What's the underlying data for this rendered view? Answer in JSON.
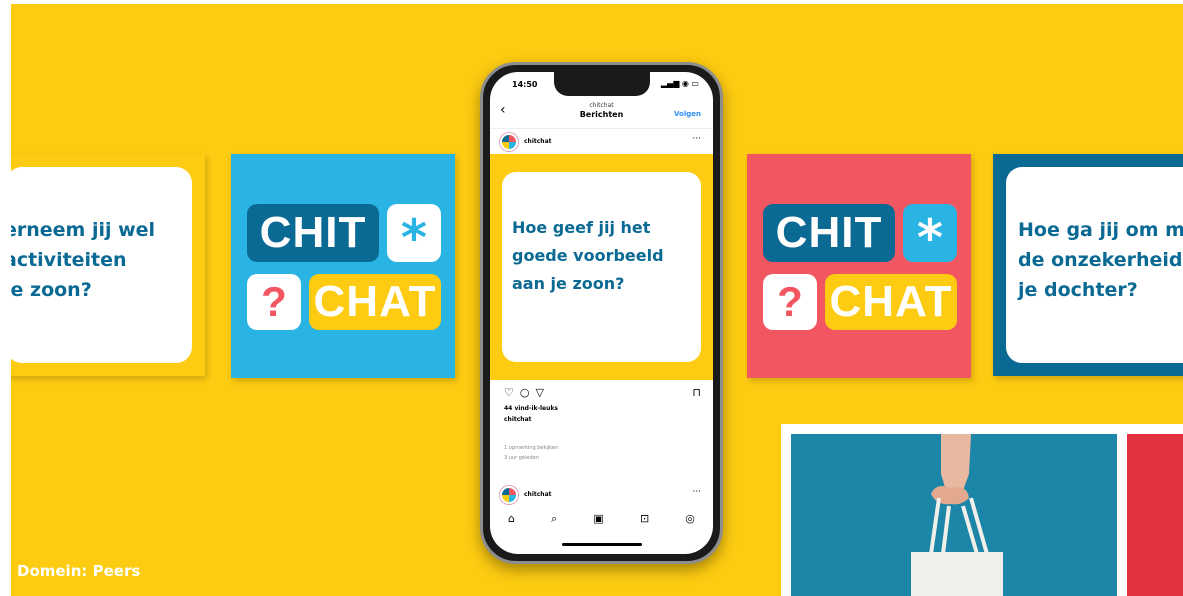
{
  "cards": {
    "left_question": "erneem jij wel\n activiteiten\nje zoon?",
    "right_question": "Hoe ga jij om m\nde onzekerheid\nje dochter?"
  },
  "logo": {
    "chit": "CHIT",
    "star": "*",
    "question": "?",
    "chat": "CHAT"
  },
  "phone": {
    "time": "14:50",
    "status_icons": "▂▄▆ ◉ ▭",
    "nav_subtitle": "chitchat",
    "nav_title": "Berichten",
    "follow": "Volgen",
    "post_user": "chitchat",
    "more": "···",
    "question": "Hoe geef jij het\ngoede voorbeeld\naan je zoon?",
    "likes": "44 vind-ik-leuks",
    "caption_user": "chitchat",
    "comments": "1 opmerking bekijken",
    "ago": "3 uur geleden",
    "post2_user": "chitchat",
    "tabs": [
      "⌂",
      "⌕",
      "▣",
      "⊡",
      "◎"
    ]
  },
  "footer": {
    "label": "Domein: Peers"
  },
  "colors": {
    "background": "#FDCB11",
    "navy": "#0B6A93",
    "sky": "#29B4E3",
    "coral": "#F25761"
  }
}
